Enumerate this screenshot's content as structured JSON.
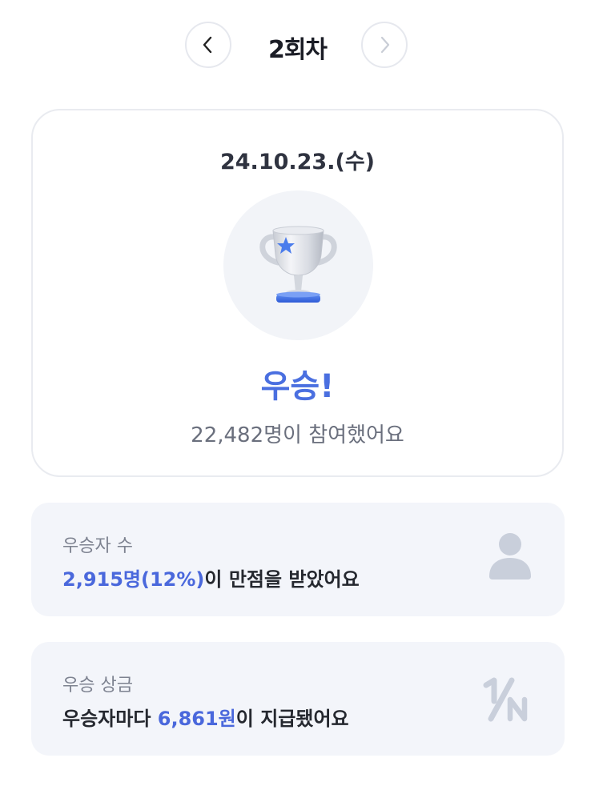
{
  "nav": {
    "title": "2회차",
    "prev_icon": "chevron-left-icon",
    "next_icon": "chevron-right-icon"
  },
  "result_card": {
    "date": "24.10.23.(수)",
    "trophy_icon": "trophy-icon",
    "result": "우승!",
    "participants": "22,482명이 참여했어요"
  },
  "winners": {
    "label": "우승자 수",
    "highlight": "2,915명(12%)",
    "suffix": "이 만점을 받았어요",
    "icon": "person-icon"
  },
  "prize": {
    "label": "우승 상금",
    "prefix": "우승자마다 ",
    "highlight": "6,861원",
    "suffix": "이 지급됐어요",
    "icon": "one-over-n-icon"
  },
  "colors": {
    "accent": "#4a6fe0",
    "card_bg": "#f3f5fa",
    "text_dark": "#25282f",
    "text_muted": "#7d8290"
  }
}
